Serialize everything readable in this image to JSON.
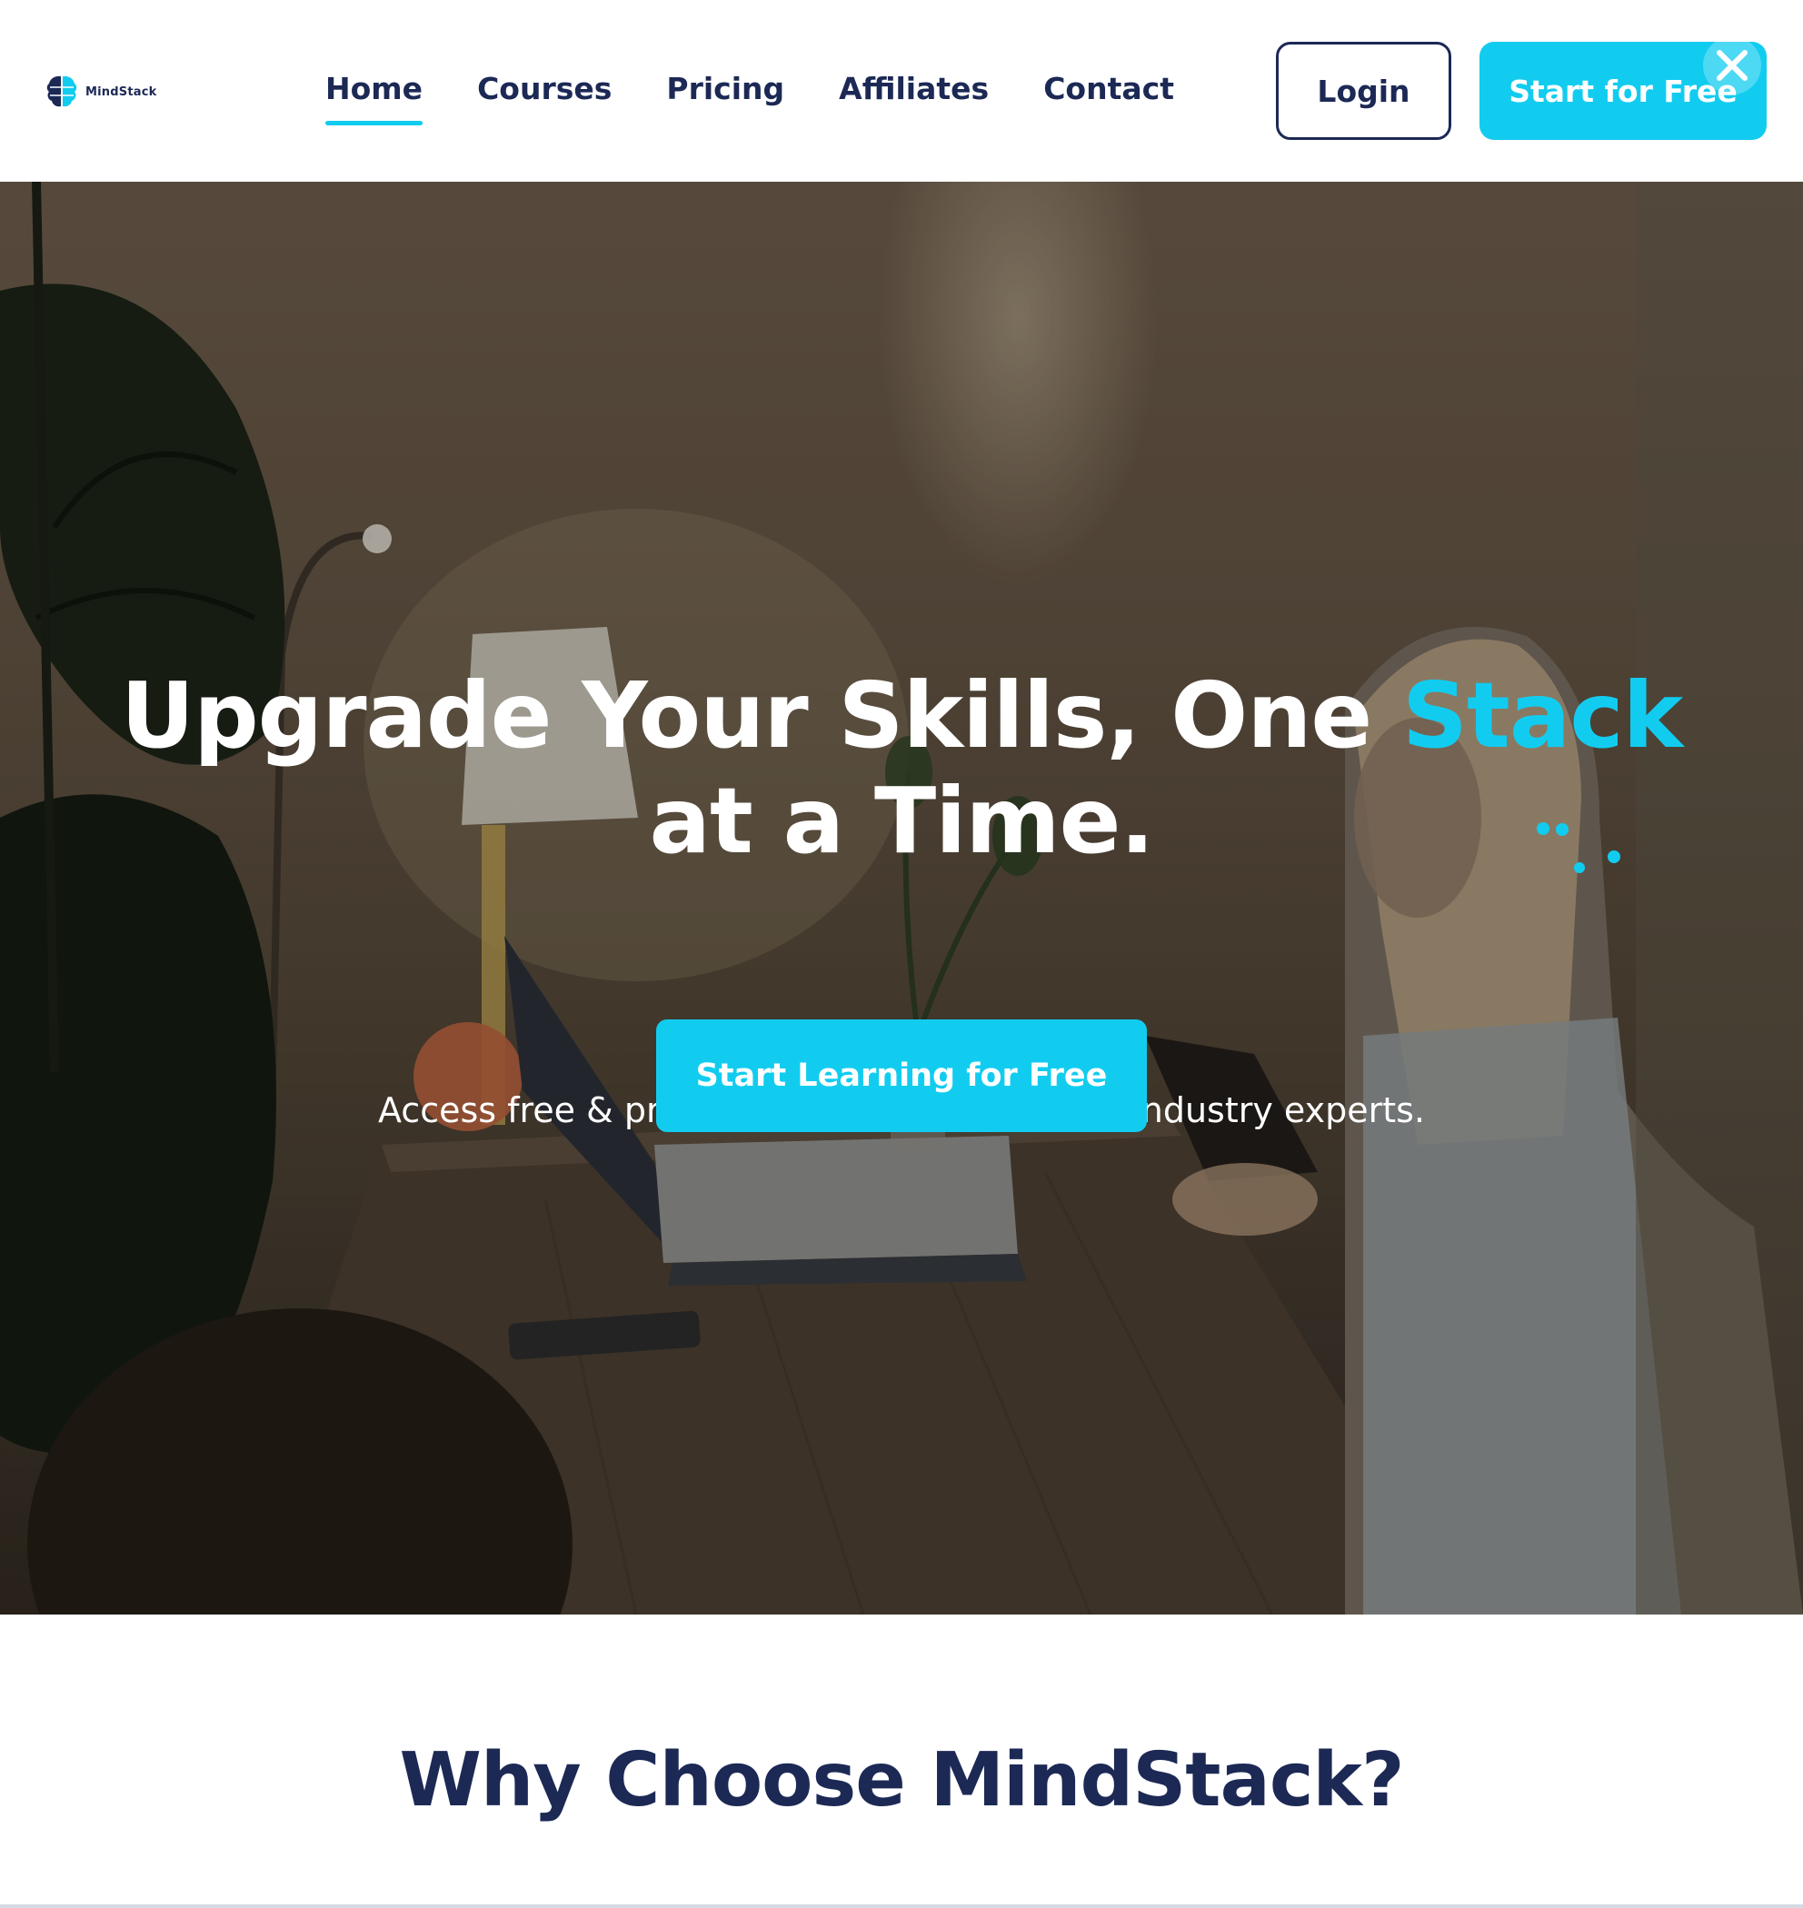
{
  "brand": {
    "name": "MindStack",
    "logo_icon": "brain-stack-icon",
    "primary_color": "#1c2955",
    "accent_color": "#12ccf0"
  },
  "nav": {
    "items": [
      {
        "label": "Home",
        "active": true
      },
      {
        "label": "Courses",
        "active": false
      },
      {
        "label": "Pricing",
        "active": false
      },
      {
        "label": "Affiliates",
        "active": false
      },
      {
        "label": "Contact",
        "active": false
      }
    ]
  },
  "header": {
    "login_label": "Login",
    "start_free_label": "Start for Free",
    "close_icon": "close-icon"
  },
  "hero": {
    "title_part1": "Upgrade Your Skills, One ",
    "title_accent": "Stack",
    "title_line2": "at a Time.",
    "subtitle": "Access free & premium video courses from industry experts.",
    "cta_label": "Start Learning for Free",
    "sparkle_icon": "sparkle-dots-icon"
  },
  "why": {
    "title": "Why Choose MindStack?"
  }
}
